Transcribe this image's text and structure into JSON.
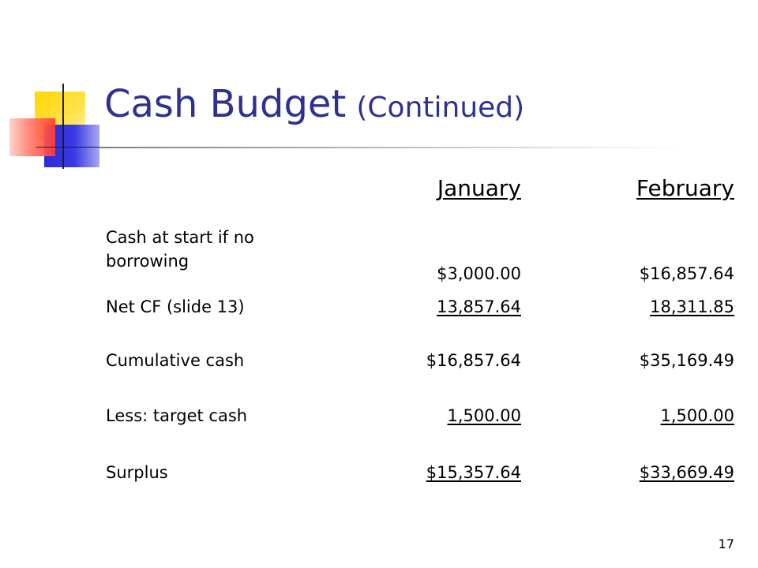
{
  "slide": {
    "title": "Cash Budget",
    "subtitle": "(Continued)",
    "page_number": "17"
  },
  "table": {
    "columns": [
      "January",
      "February"
    ],
    "rows": [
      {
        "label": "Cash at start if no borrowing",
        "values": [
          "$3,000.00",
          "$16,857.64"
        ],
        "underlined": false
      },
      {
        "label": "Net CF (slide 13)",
        "values": [
          "13,857.64",
          "18,311.85"
        ],
        "underlined": true
      },
      {
        "label": "Cumulative cash",
        "values": [
          "$16,857.64",
          "$35,169.49"
        ],
        "underlined": false
      },
      {
        "label": "Less: target cash",
        "values": [
          "1,500.00",
          "1,500.00"
        ],
        "underlined": true
      },
      {
        "label": "Surplus",
        "values": [
          "$15,357.64",
          "$33,669.49"
        ],
        "underlined": true
      }
    ]
  },
  "colors": {
    "title": "#2e3192",
    "deco_yellow": "#ffd700",
    "deco_blue": "#2b2bd8",
    "deco_red": "#ff3b30"
  }
}
